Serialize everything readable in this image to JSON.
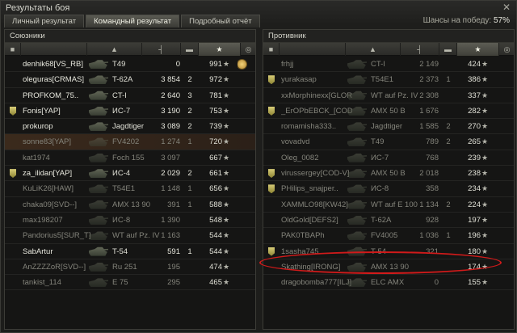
{
  "window": {
    "title": "Результаты боя",
    "close_label": "✕"
  },
  "tabs": [
    {
      "label": "Личный результат",
      "active": false
    },
    {
      "label": "Командный результат",
      "active": true
    },
    {
      "label": "Подробный отчёт",
      "active": false
    }
  ],
  "win_chance": {
    "label": "Шансы на победу:",
    "value": "57%"
  },
  "teams": {
    "allies": {
      "title": "Союзники",
      "rows": [
        {
          "player": "denhik68[VS_RB]",
          "tank": "T49",
          "damage": "0",
          "frags": "",
          "xp": "991",
          "dead": false,
          "clan_icon": false,
          "medal": true,
          "highlight": false
        },
        {
          "player": "oleguras[CRMAS]",
          "tank": "T-62A",
          "damage": "3 854",
          "frags": "2",
          "xp": "972",
          "dead": false,
          "clan_icon": false,
          "medal": false,
          "highlight": false
        },
        {
          "player": "PROFKOM_75..",
          "tank": "CT-I",
          "damage": "2 640",
          "frags": "3",
          "xp": "781",
          "dead": false,
          "clan_icon": false,
          "medal": false,
          "highlight": false
        },
        {
          "player": "Fonis[YAP]",
          "tank": "ИС-7",
          "damage": "3 190",
          "frags": "2",
          "xp": "753",
          "dead": false,
          "clan_icon": true,
          "medal": false,
          "highlight": false
        },
        {
          "player": "prokurop",
          "tank": "Jagdtiger",
          "damage": "3 089",
          "frags": "2",
          "xp": "739",
          "dead": false,
          "clan_icon": false,
          "medal": false,
          "highlight": false
        },
        {
          "player": "sonne83[YAP]",
          "tank": "FV4202",
          "damage": "1 274",
          "frags": "1",
          "xp": "720",
          "dead": true,
          "clan_icon": false,
          "medal": false,
          "highlight": true
        },
        {
          "player": "kat1974",
          "tank": "Foch 155",
          "damage": "3 097",
          "frags": "",
          "xp": "667",
          "dead": true,
          "clan_icon": false,
          "medal": false,
          "highlight": false
        },
        {
          "player": "za_ilidan[YAP]",
          "tank": "ИС-4",
          "damage": "2 029",
          "frags": "2",
          "xp": "661",
          "dead": false,
          "clan_icon": true,
          "medal": false,
          "highlight": false
        },
        {
          "player": "KuLiK26[HAW]",
          "tank": "T54E1",
          "damage": "1 148",
          "frags": "1",
          "xp": "656",
          "dead": true,
          "clan_icon": false,
          "medal": false,
          "highlight": false
        },
        {
          "player": "chaka09[SVD--]",
          "tank": "AMX 13 90",
          "damage": "391",
          "frags": "1",
          "xp": "588",
          "dead": true,
          "clan_icon": false,
          "medal": false,
          "highlight": false
        },
        {
          "player": "max198207",
          "tank": "ИС-8",
          "damage": "1 390",
          "frags": "",
          "xp": "548",
          "dead": true,
          "clan_icon": false,
          "medal": false,
          "highlight": false
        },
        {
          "player": "Pandorius5[SUR_T]",
          "tank": "WT auf Pz. IV",
          "damage": "1 163",
          "frags": "",
          "xp": "544",
          "dead": true,
          "clan_icon": false,
          "medal": false,
          "highlight": false
        },
        {
          "player": "SabArtur",
          "tank": "T-54",
          "damage": "591",
          "frags": "1",
          "xp": "544",
          "dead": false,
          "clan_icon": false,
          "medal": false,
          "highlight": false
        },
        {
          "player": "AnZZZZoR[SVD--]",
          "tank": "Ru 251",
          "damage": "195",
          "frags": "",
          "xp": "474",
          "dead": true,
          "clan_icon": false,
          "medal": false,
          "highlight": false
        },
        {
          "player": "tankist_114",
          "tank": "E 75",
          "damage": "295",
          "frags": "",
          "xp": "465",
          "dead": true,
          "clan_icon": false,
          "medal": false,
          "highlight": false
        }
      ]
    },
    "enemies": {
      "title": "Противник",
      "rows": [
        {
          "player": "frhjj",
          "tank": "CT-I",
          "damage": "2 149",
          "frags": "",
          "xp": "424",
          "dead": true,
          "clan_icon": false,
          "medal": false,
          "highlight": false
        },
        {
          "player": "yurakasap",
          "tank": "T54E1",
          "damage": "2 373",
          "frags": "1",
          "xp": "386",
          "dead": true,
          "clan_icon": true,
          "medal": false,
          "highlight": false
        },
        {
          "player": "xxMorphinexx[GLORI]",
          "tank": "WT auf Pz. IV",
          "damage": "2 308",
          "frags": "",
          "xp": "337",
          "dead": true,
          "clan_icon": false,
          "medal": false,
          "highlight": false
        },
        {
          "player": "_ErOPbEBCK_[COD-V]",
          "tank": "AMX 50 B",
          "damage": "1 676",
          "frags": "",
          "xp": "282",
          "dead": true,
          "clan_icon": true,
          "medal": false,
          "highlight": false
        },
        {
          "player": "romamisha333..",
          "tank": "Jagdtiger",
          "damage": "1 585",
          "frags": "2",
          "xp": "270",
          "dead": true,
          "clan_icon": false,
          "medal": false,
          "highlight": false
        },
        {
          "player": "vovadvd",
          "tank": "T49",
          "damage": "789",
          "frags": "2",
          "xp": "265",
          "dead": true,
          "clan_icon": false,
          "medal": false,
          "highlight": false
        },
        {
          "player": "Oleg_0082",
          "tank": "ИС-7",
          "damage": "768",
          "frags": "",
          "xp": "239",
          "dead": true,
          "clan_icon": false,
          "medal": false,
          "highlight": false
        },
        {
          "player": "virussergey[COD-V]",
          "tank": "AMX 50 B",
          "damage": "2 018",
          "frags": "",
          "xp": "238",
          "dead": true,
          "clan_icon": true,
          "medal": false,
          "highlight": false
        },
        {
          "player": "PHilips_snajper..",
          "tank": "ИС-8",
          "damage": "358",
          "frags": "",
          "xp": "234",
          "dead": true,
          "clan_icon": true,
          "medal": false,
          "highlight": false
        },
        {
          "player": "XAMMLO98[KW42]",
          "tank": "WT auf E 100",
          "damage": "1 134",
          "frags": "2",
          "xp": "224",
          "dead": true,
          "clan_icon": false,
          "medal": false,
          "highlight": false
        },
        {
          "player": "OldGold[DEFS2]",
          "tank": "T-62A",
          "damage": "928",
          "frags": "",
          "xp": "197",
          "dead": true,
          "clan_icon": false,
          "medal": false,
          "highlight": false
        },
        {
          "player": "PAK0TBAPh",
          "tank": "FV4005",
          "damage": "1 036",
          "frags": "1",
          "xp": "196",
          "dead": true,
          "clan_icon": false,
          "medal": false,
          "highlight": false
        },
        {
          "player": "1sasha745",
          "tank": "T-54",
          "damage": "321",
          "frags": "",
          "xp": "180",
          "dead": true,
          "clan_icon": true,
          "medal": false,
          "highlight": false
        },
        {
          "player": "Skathing[IRONG]",
          "tank": "AMX 13 90",
          "damage": "",
          "frags": "",
          "xp": "174",
          "dead": true,
          "clan_icon": false,
          "medal": false,
          "highlight": false
        },
        {
          "player": "dragobomba777[ILJ]",
          "tank": "ELC AMX",
          "damage": "0",
          "frags": "",
          "xp": "155",
          "dead": true,
          "clan_icon": false,
          "medal": false,
          "highlight": false
        }
      ]
    }
  },
  "icons": {
    "star": "★",
    "medal": "medal-icon",
    "clan": "clan-shield-icon",
    "tank": "tank-icon"
  },
  "colors": {
    "highlight_ring": "#d11a1a",
    "accent_gold": "#d8cd78"
  }
}
